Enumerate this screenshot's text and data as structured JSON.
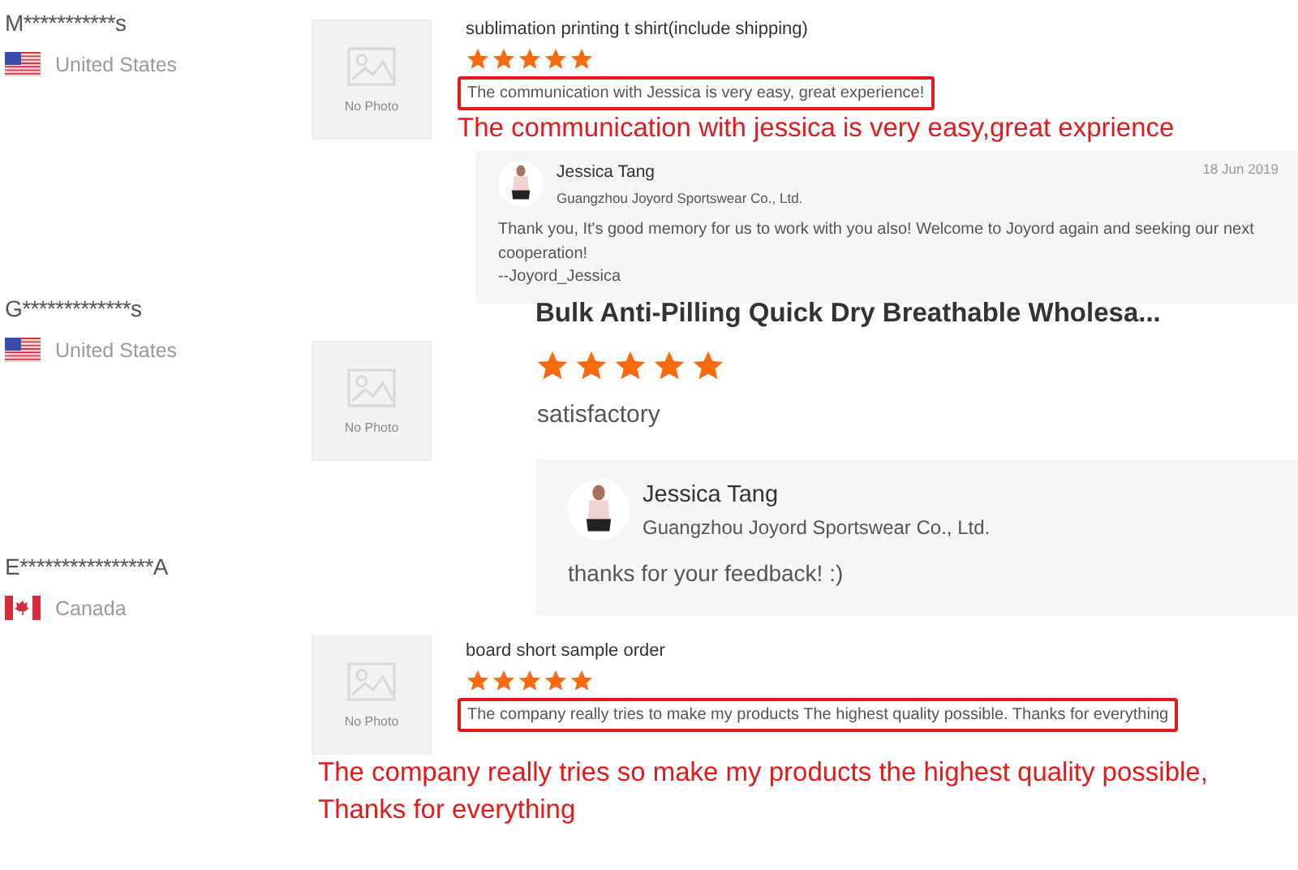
{
  "reviews": [
    {
      "kind": "compact",
      "buyer": "M***********s",
      "flag": {
        "kind": "us"
      },
      "country": "United States",
      "photo_label": "No Photo",
      "product": "sublimation printing t shirt(include shipping)",
      "stars": 5,
      "comment": "The communication with Jessica is very easy, great experience!",
      "highlighted": true,
      "annotation": [
        "The communication with jessica is very easy,great exprience"
      ],
      "reply": {
        "name": "Jessica Tang",
        "company": "Guangzhou Joyord Sportswear Co., Ltd.",
        "date": "18 Jun 2019",
        "lines": [
          "Thank you, It's good memory for us to work with you also! Welcome to Joyord again and seeking our next cooperation!",
          "--Joyord_Jessica"
        ]
      }
    },
    {
      "kind": "large",
      "buyer": "G*************s",
      "flag": {
        "kind": "us"
      },
      "country": "United States",
      "photo_label": "No Photo",
      "product": "Bulk Anti-Pilling Quick Dry Breathable Wholesa...",
      "stars": 5,
      "comment": "satisfactory",
      "highlighted": false,
      "reply": {
        "name": "Jessica Tang",
        "company": "Guangzhou Joyord Sportswear Co., Ltd.",
        "lines": [
          "thanks for your feedback! :)"
        ]
      }
    },
    {
      "kind": "compact",
      "buyer": "E****************A",
      "flag": {
        "kind": "ca"
      },
      "country": "Canada",
      "photo_label": "No Photo",
      "product": "board short sample order",
      "stars": 5,
      "comment": "The company really tries to make my products The highest quality possible. Thanks for everything",
      "highlighted": true,
      "annotation": [
        "The company really tries so make my products the highest quality possible,",
        "Thanks for everything"
      ]
    }
  ]
}
